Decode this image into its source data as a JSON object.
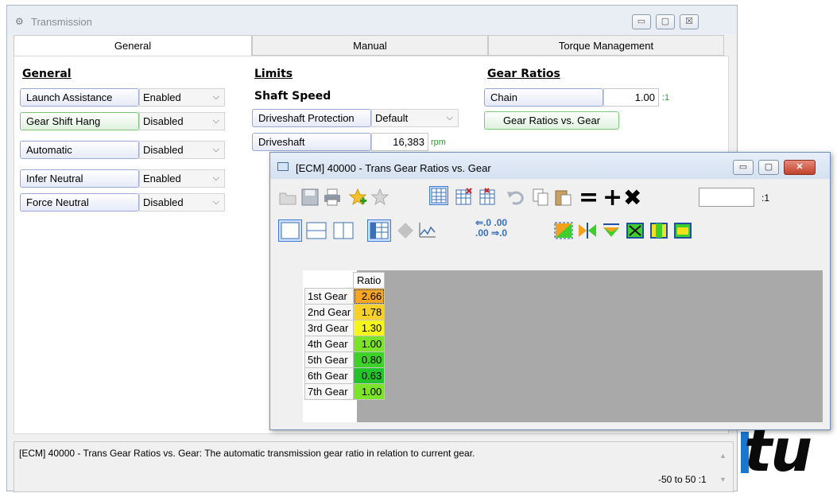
{
  "brand": {
    "text": "tu"
  },
  "main_window": {
    "title": "Transmission",
    "controls": {
      "minimize": "▭",
      "maximize": "▢",
      "close": "☒"
    }
  },
  "tabs": [
    {
      "label": "General"
    },
    {
      "label": "Manual"
    },
    {
      "label": "Torque Management"
    }
  ],
  "general": {
    "title": "General",
    "rows": [
      {
        "label": "Launch Assistance",
        "value": "Enabled"
      },
      {
        "label": "Gear Shift Hang",
        "value": "Disabled"
      },
      {
        "label": "Automatic",
        "value": "Disabled"
      },
      {
        "label": "Infer Neutral",
        "value": "Enabled"
      },
      {
        "label": "Force Neutral",
        "value": "Disabled"
      }
    ]
  },
  "limits": {
    "title": "Limits",
    "shaft_speed_title": "Shaft Speed",
    "driveshaft_protection": {
      "label": "Driveshaft Protection",
      "value": "Default"
    },
    "driveshaft": {
      "label": "Driveshaft",
      "value": "16,383",
      "unit": "rpm"
    }
  },
  "gear_ratios": {
    "title": "Gear Ratios",
    "chain": {
      "label": "Chain",
      "value": "1.00",
      "unit": ":1"
    },
    "button": "Gear Ratios vs. Gear"
  },
  "status": {
    "text": "[ECM] 40000 - Trans Gear Ratios vs. Gear: The automatic transmission gear ratio in relation to current gear.",
    "range": "-50 to 50 :1"
  },
  "child_window": {
    "title": "[ECM] 40000 - Trans Gear Ratios vs. Gear",
    "factor_unit": ":1",
    "increment_labels": {
      "top": "⇐.0 .00",
      "bottom": ".00 ⇒.0"
    },
    "table": {
      "header": "Ratio",
      "rows": [
        {
          "gear": "1st Gear",
          "ratio": "2.66",
          "color": "#f5a623"
        },
        {
          "gear": "2nd Gear",
          "ratio": "1.78",
          "color": "#f7d12a"
        },
        {
          "gear": "3rd Gear",
          "ratio": "1.30",
          "color": "#f5f51d"
        },
        {
          "gear": "4th Gear",
          "ratio": "1.00",
          "color": "#7be32a"
        },
        {
          "gear": "5th Gear",
          "ratio": "0.80",
          "color": "#3fd12a"
        },
        {
          "gear": "6th Gear",
          "ratio": "0.63",
          "color": "#22c42a"
        },
        {
          "gear": "7th Gear",
          "ratio": "1.00",
          "color": "#7be32a"
        }
      ]
    }
  }
}
